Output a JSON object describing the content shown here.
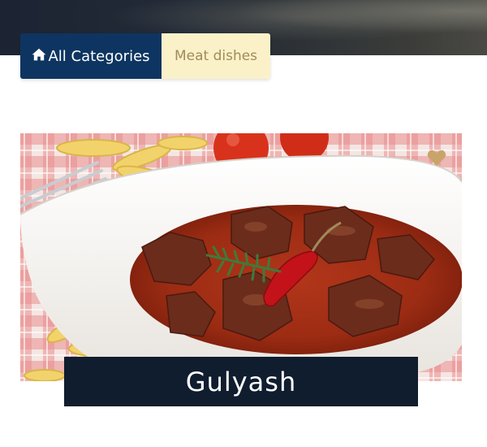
{
  "breadcrumb": {
    "home_label": "All Categories",
    "current_label": "Meat dishes"
  },
  "dish": {
    "title": "Gulyash"
  },
  "icons": {
    "home": "home-icon",
    "favorite": "heart-icon"
  },
  "colors": {
    "breadcrumb_home_bg": "#0e3561",
    "breadcrumb_current_bg": "#fbf1c9",
    "title_bar_bg": "#0f1d2e",
    "favorite": "#c9a46a"
  }
}
